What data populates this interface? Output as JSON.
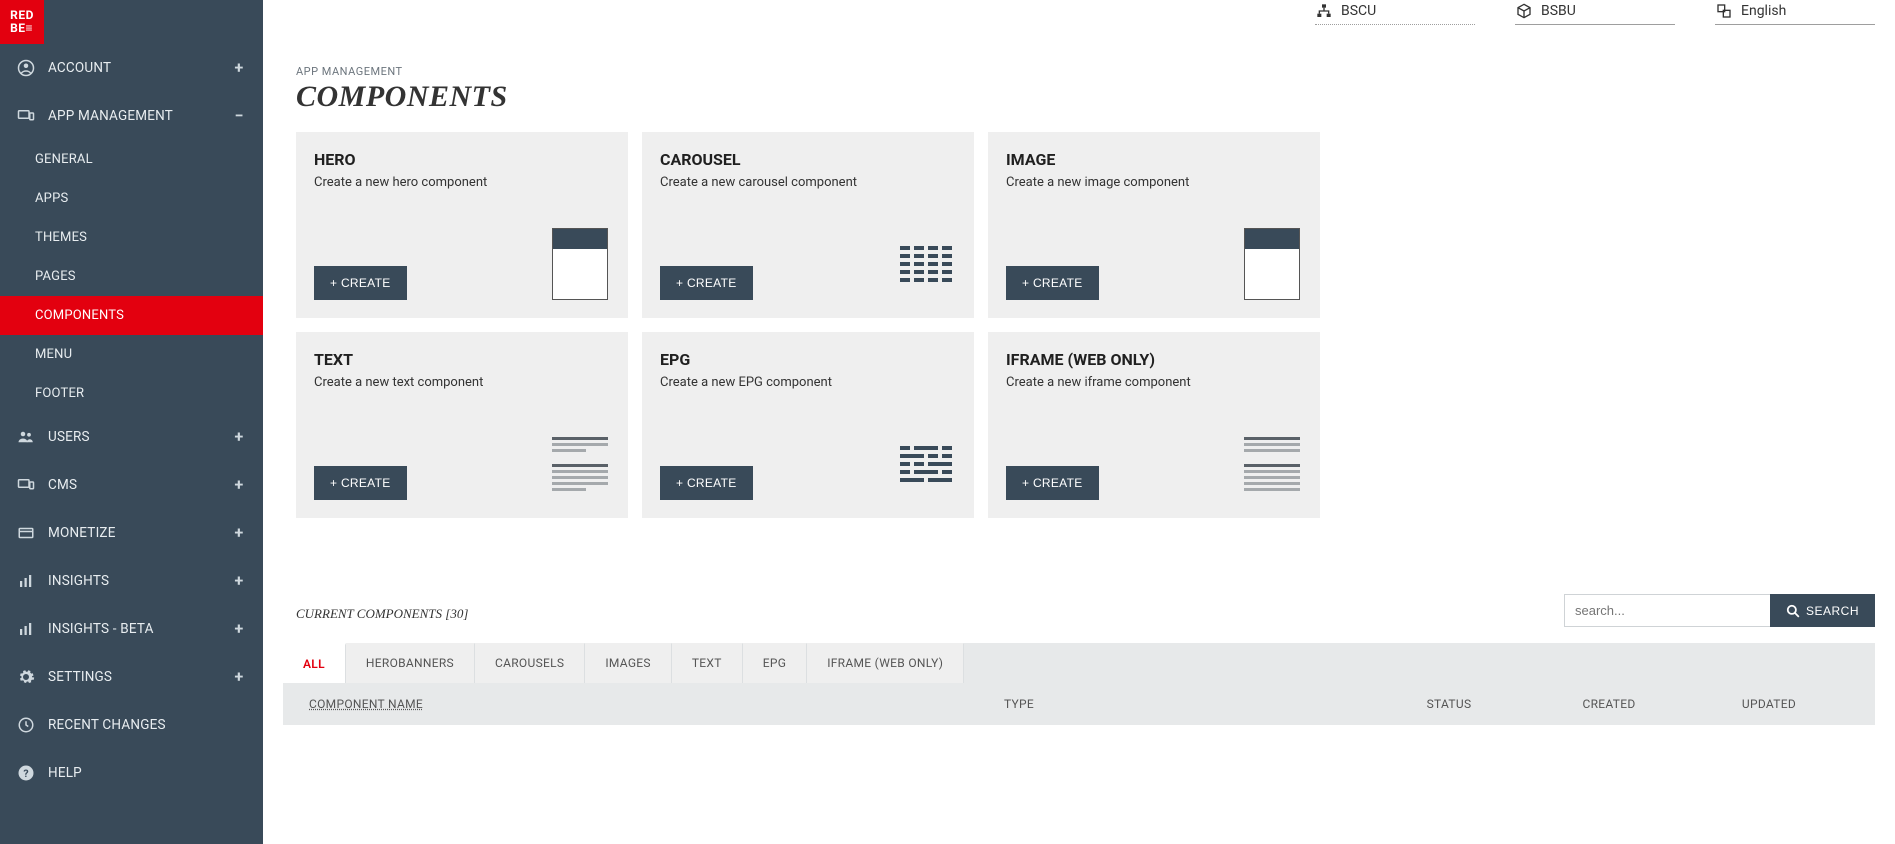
{
  "brand": {
    "logo_text": "RED\nBE≡"
  },
  "topbar": {
    "cu": "BSCU",
    "bu": "BSBU",
    "lang": "English"
  },
  "sidebar": {
    "account": "ACCOUNT",
    "app_mgmt": "APP MANAGEMENT",
    "app_mgmt_children": {
      "general": "GENERAL",
      "apps": "APPS",
      "themes": "THEMES",
      "pages": "PAGES",
      "components": "COMPONENTS",
      "menu": "MENU",
      "footer": "FOOTER"
    },
    "users": "USERS",
    "cms": "CMS",
    "monetize": "MONETIZE",
    "insights": "INSIGHTS",
    "insights_beta": "INSIGHTS - BETA",
    "settings": "SETTINGS",
    "recent_changes": "RECENT CHANGES",
    "help": "HELP"
  },
  "breadcrumb": "APP MANAGEMENT",
  "page_title": "COMPONENTS",
  "create_label": "+ CREATE",
  "cards": {
    "hero": {
      "title": "HERO",
      "desc": "Create a new hero component"
    },
    "carousel": {
      "title": "CAROUSEL",
      "desc": "Create a new carousel component"
    },
    "image": {
      "title": "IMAGE",
      "desc": "Create a new image component"
    },
    "text": {
      "title": "TEXT",
      "desc": "Create a new text component"
    },
    "epg": {
      "title": "EPG",
      "desc": "Create a new EPG component"
    },
    "iframe": {
      "title": "IFRAME (WEB ONLY)",
      "desc": "Create a new iframe component"
    }
  },
  "current_components": {
    "title": "CURRENT COMPONENTS [30]",
    "search_placeholder": "search...",
    "search_button": "SEARCH"
  },
  "tabs": {
    "all": "ALL",
    "herobanners": "HEROBANNERS",
    "carousels": "CAROUSELS",
    "images": "IMAGES",
    "text": "TEXT",
    "epg": "EPG",
    "iframe": "IFRAME (WEB ONLY)"
  },
  "table_headers": {
    "name": "COMPONENT NAME",
    "type": "TYPE",
    "status": "STATUS",
    "created": "CREATED",
    "updated": "UPDATED"
  }
}
